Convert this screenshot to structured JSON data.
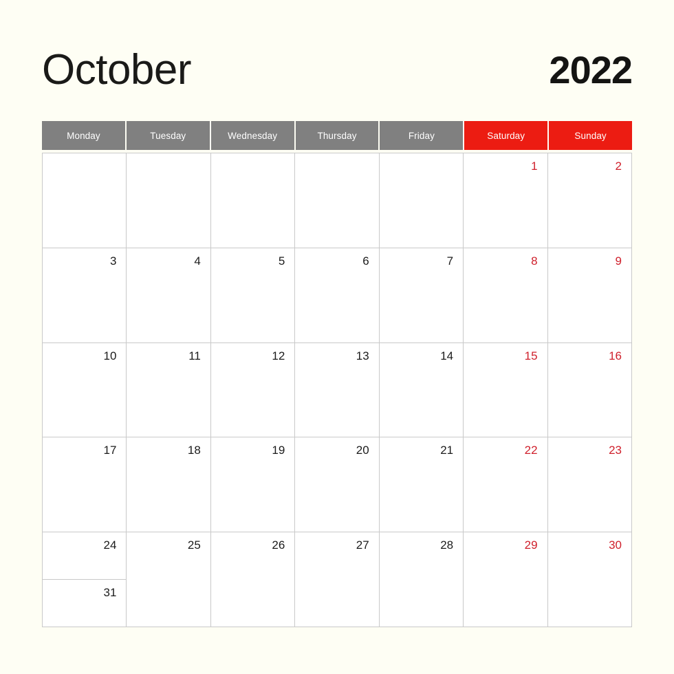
{
  "header": {
    "month": "October",
    "year": "2022"
  },
  "weekdays": [
    {
      "label": "Monday",
      "weekend": false
    },
    {
      "label": "Tuesday",
      "weekend": false
    },
    {
      "label": "Wednesday",
      "weekend": false
    },
    {
      "label": "Thursday",
      "weekend": false
    },
    {
      "label": "Friday",
      "weekend": false
    },
    {
      "label": "Saturday",
      "weekend": true
    },
    {
      "label": "Sunday",
      "weekend": true
    }
  ],
  "colors": {
    "page_background": "#fefef4",
    "cell_background": "#ffffff",
    "grid_line": "#c9c9c9",
    "weekday_header": "#808080",
    "weekend_header": "#ec1c12",
    "weekend_number": "#cf1f2b",
    "weekday_number": "#1b1b1b",
    "title_text": "#1a1a18"
  },
  "weeks": [
    [
      {
        "day": "",
        "weekend": false,
        "empty": true
      },
      {
        "day": "",
        "weekend": false,
        "empty": true
      },
      {
        "day": "",
        "weekend": false,
        "empty": true
      },
      {
        "day": "",
        "weekend": false,
        "empty": true
      },
      {
        "day": "",
        "weekend": false,
        "empty": true
      },
      {
        "day": "1",
        "weekend": true,
        "empty": false
      },
      {
        "day": "2",
        "weekend": true,
        "empty": false
      }
    ],
    [
      {
        "day": "3",
        "weekend": false,
        "empty": false
      },
      {
        "day": "4",
        "weekend": false,
        "empty": false
      },
      {
        "day": "5",
        "weekend": false,
        "empty": false
      },
      {
        "day": "6",
        "weekend": false,
        "empty": false
      },
      {
        "day": "7",
        "weekend": false,
        "empty": false
      },
      {
        "day": "8",
        "weekend": true,
        "empty": false
      },
      {
        "day": "9",
        "weekend": true,
        "empty": false
      }
    ],
    [
      {
        "day": "10",
        "weekend": false,
        "empty": false
      },
      {
        "day": "11",
        "weekend": false,
        "empty": false
      },
      {
        "day": "12",
        "weekend": false,
        "empty": false
      },
      {
        "day": "13",
        "weekend": false,
        "empty": false
      },
      {
        "day": "14",
        "weekend": false,
        "empty": false
      },
      {
        "day": "15",
        "weekend": true,
        "empty": false
      },
      {
        "day": "16",
        "weekend": true,
        "empty": false
      }
    ],
    [
      {
        "day": "17",
        "weekend": false,
        "empty": false
      },
      {
        "day": "18",
        "weekend": false,
        "empty": false
      },
      {
        "day": "19",
        "weekend": false,
        "empty": false
      },
      {
        "day": "20",
        "weekend": false,
        "empty": false
      },
      {
        "day": "21",
        "weekend": false,
        "empty": false
      },
      {
        "day": "22",
        "weekend": true,
        "empty": false
      },
      {
        "day": "23",
        "weekend": true,
        "empty": false
      }
    ],
    [
      {
        "day": "24",
        "day2": "31",
        "weekend": false,
        "empty": false,
        "split": true
      },
      {
        "day": "25",
        "weekend": false,
        "empty": false
      },
      {
        "day": "26",
        "weekend": false,
        "empty": false
      },
      {
        "day": "27",
        "weekend": false,
        "empty": false
      },
      {
        "day": "28",
        "weekend": false,
        "empty": false
      },
      {
        "day": "29",
        "weekend": true,
        "empty": false
      },
      {
        "day": "30",
        "weekend": true,
        "empty": false
      }
    ]
  ]
}
